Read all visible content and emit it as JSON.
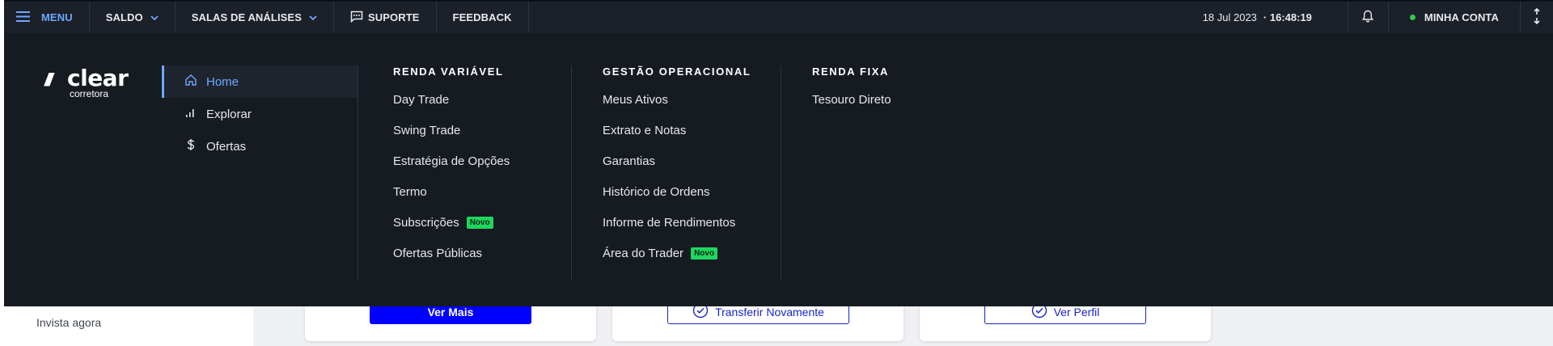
{
  "topbar": {
    "menu_label": "MENU",
    "saldo_label": "SALDO",
    "salas_label": "SALAS DE ANÁLISES",
    "suporte_label": "SUPORTE",
    "feedback_label": "FEEDBACK",
    "date": "18 Jul 2023",
    "time": "· 16:48:19",
    "account_label": "MINHA CONTA",
    "status_color": "#30c948"
  },
  "logo": {
    "slashes": "/////",
    "word": "clear",
    "sub": "corretora"
  },
  "nav": {
    "items": [
      {
        "label": "Home",
        "icon": "home-icon",
        "active": true
      },
      {
        "label": "Explorar",
        "icon": "bar-chart-icon",
        "active": false
      },
      {
        "label": "Ofertas",
        "icon": "dollar-icon",
        "active": false
      }
    ]
  },
  "columns": [
    {
      "title": "RENDA VARIÁVEL",
      "links": [
        {
          "label": "Day Trade",
          "badge": ""
        },
        {
          "label": "Swing Trade",
          "badge": ""
        },
        {
          "label": "Estratégia de Opções",
          "badge": ""
        },
        {
          "label": "Termo",
          "badge": ""
        },
        {
          "label": "Subscrições",
          "badge": "Novo"
        },
        {
          "label": "Ofertas Públicas",
          "badge": ""
        }
      ]
    },
    {
      "title": "GESTÃO OPERACIONAL",
      "links": [
        {
          "label": "Meus Ativos",
          "badge": ""
        },
        {
          "label": "Extrato e Notas",
          "badge": ""
        },
        {
          "label": "Garantias",
          "badge": ""
        },
        {
          "label": "Histórico de Ordens",
          "badge": ""
        },
        {
          "label": "Informe de Rendimentos",
          "badge": ""
        },
        {
          "label": "Área do Trader",
          "badge": "Novo"
        }
      ]
    },
    {
      "title": "RENDA FIXA",
      "links": [
        {
          "label": "Tesouro Direto",
          "badge": ""
        }
      ]
    }
  ],
  "background": {
    "invista_label": "Invista agora",
    "ver_mais_label": "Ver Mais",
    "transferir_label": "Transferir Novamente",
    "ver_perfil_label": "Ver Perfil"
  },
  "colors": {
    "accent": "#6ea8ff",
    "badge": "#1fd65f",
    "primary_button": "#0000ff"
  }
}
